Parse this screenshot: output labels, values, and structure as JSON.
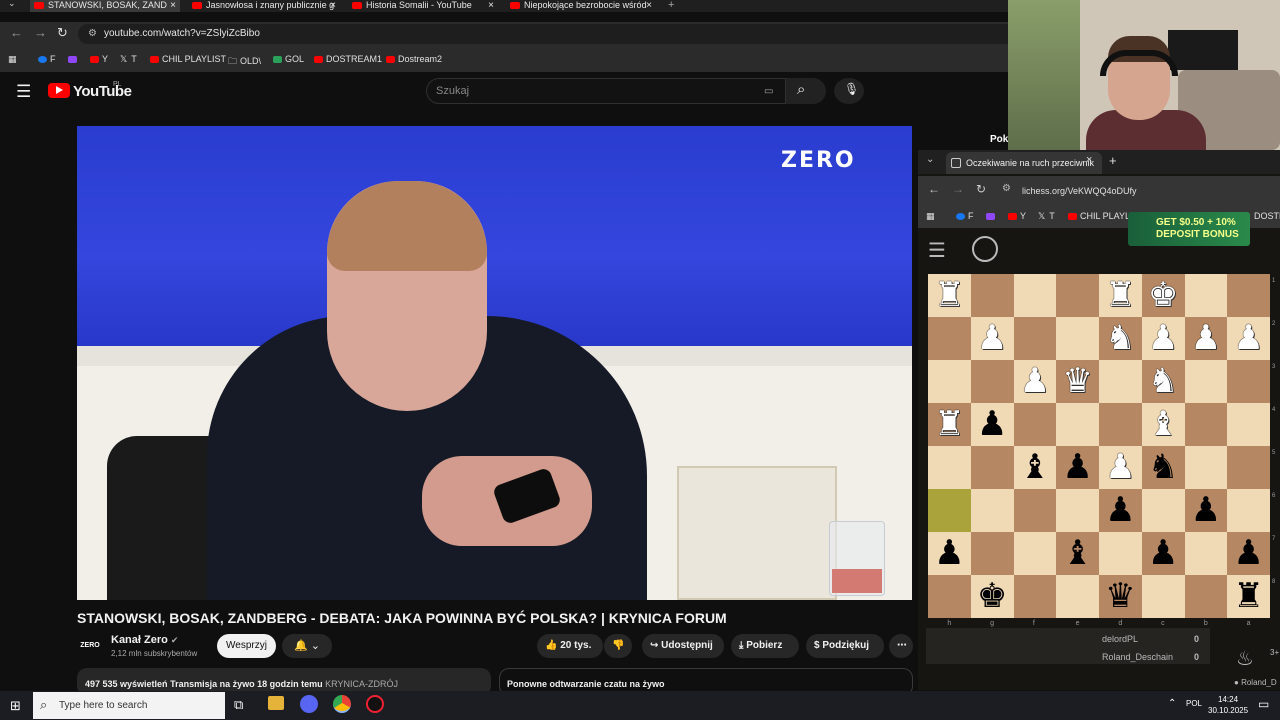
{
  "browser": {
    "tabs": [
      {
        "label": "STANOWSKI, BOSAK, ZAND",
        "active": true
      },
      {
        "label": "Jasnowłosa i znany publicznie g"
      },
      {
        "label": "Historia Somalii - YouTube"
      },
      {
        "label": "Niepokojące bezrobocie wśród"
      }
    ],
    "url": "youtube.com/watch?v=ZSlyiZcBibo",
    "bookmarks": [
      "F",
      "Y",
      "T",
      "CHIL PLAYLIST",
      "OLD\\",
      "GOL",
      "DOSTREAM1",
      "Dostream2"
    ]
  },
  "youtube": {
    "logo_text": "YouTube",
    "country": "PL",
    "search_placeholder": "Szukaj",
    "video_overlay_logo": "ZERO",
    "title": "STANOWSKI, BOSAK, ZANDBERG - DEBATA: JAKA POWINNA BYĆ POLSKA? | KRYNICA FORUM",
    "channel": {
      "logo": "ZERO",
      "name": "Kanał Zero",
      "subs": "2,12 mln subskrybentów"
    },
    "support_label": "Wesprzyj",
    "bell_label": "🔔 ⌄",
    "likes": "20 tys.",
    "share": "Udostępnij",
    "download": "Pobierz",
    "thanks": "Podziękuj",
    "more": "⋯",
    "description": {
      "views": "497 535 wyświetleń",
      "live": "Transmisja na żywo 18 godzin temu",
      "place": "KRYNICA-ZDRÓJ"
    },
    "chat_replay": "Ponowne odtwarzanie czatu na żywo",
    "partial_label": "Pok"
  },
  "lichess": {
    "tab_label": "Oczekiwanie na ruch przeciwnik",
    "url": "lichess.org/VeKWQQ4oDUfy",
    "bookmarks": [
      "F",
      "Y",
      "T",
      "CHIL PLAYLIS",
      "DOSTREA"
    ],
    "ad_text": "GET $0.50 + 10% DEPOSIT BONUS",
    "board": [
      [
        "♜w",
        "",
        "",
        "",
        "♜w",
        "♚w",
        "",
        ""
      ],
      [
        "",
        "♟w",
        "",
        "",
        "♞w",
        "♟w",
        "♟w",
        "♟w"
      ],
      [
        "",
        "",
        "♟w",
        "♛w",
        "",
        "♞w",
        "",
        ""
      ],
      [
        "♜w",
        "♟b",
        "",
        "",
        "",
        "♝w",
        "",
        ""
      ],
      [
        "",
        "",
        "♝b",
        "♟b",
        "♟w",
        "♞b",
        "",
        ""
      ],
      [
        "",
        "",
        "",
        "",
        "♟b",
        "",
        "♟b",
        ""
      ],
      [
        "♟b",
        "",
        "",
        "♝b",
        "",
        "♟b",
        "",
        "♟b"
      ],
      [
        "",
        "♚b",
        "",
        "",
        "♛b",
        "",
        "",
        "♜b"
      ]
    ],
    "files": [
      "h",
      "g",
      "f",
      "e",
      "d",
      "c",
      "b",
      "a"
    ],
    "ranks": [
      "1",
      "2",
      "3",
      "4",
      "5",
      "6",
      "7",
      "8"
    ],
    "players": [
      {
        "name": "delordPL",
        "score": "0"
      },
      {
        "name": "Roland_Deschain",
        "score": "0"
      }
    ],
    "side_text": "3+",
    "side_name": "Roland_D"
  },
  "taskbar": {
    "search": "Type here to search",
    "lang": "POL",
    "time": "14:24",
    "date": "30.10.2025"
  }
}
